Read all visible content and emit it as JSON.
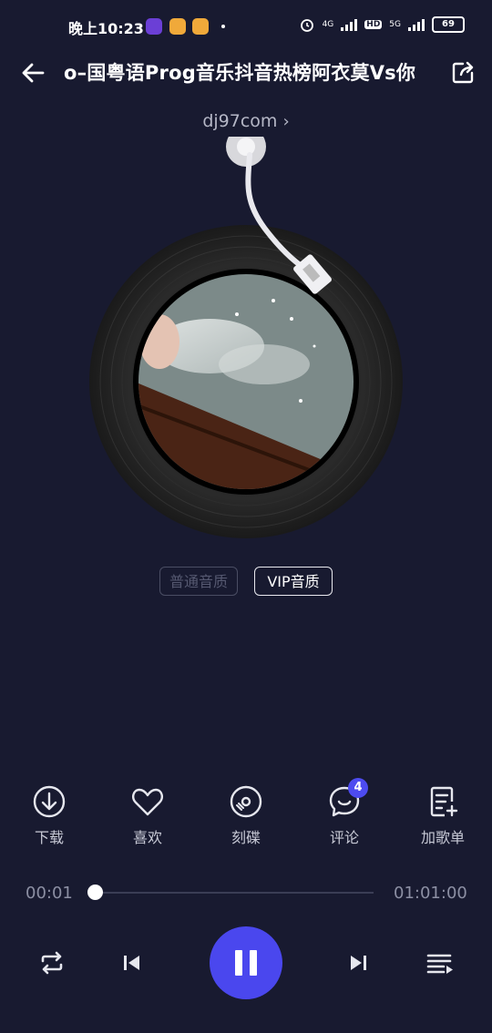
{
  "status_bar": {
    "time": "晚上10:23",
    "network_1": "4G",
    "hd": "HD",
    "network_2": "5G",
    "battery": "69"
  },
  "header": {
    "title": "o–国粤语Prog音乐抖音热榜阿衣莫Vs你",
    "artist": "dj97com"
  },
  "quality": {
    "normal": "普通音质",
    "vip": "VIP音质"
  },
  "actions": [
    {
      "label": "下载",
      "icon": "download-icon"
    },
    {
      "label": "喜欢",
      "icon": "heart-icon"
    },
    {
      "label": "刻碟",
      "icon": "disc-icon"
    },
    {
      "label": "评论",
      "icon": "comment-icon",
      "badge": "4"
    },
    {
      "label": "加歌单",
      "icon": "add-to-playlist-icon"
    }
  ],
  "progress": {
    "elapsed": "00:01",
    "total": "01:01:00",
    "fraction": 0.0003
  },
  "colors": {
    "background": "#181a30",
    "accent": "#4a47ee",
    "text_secondary": "#8c8fa3"
  }
}
